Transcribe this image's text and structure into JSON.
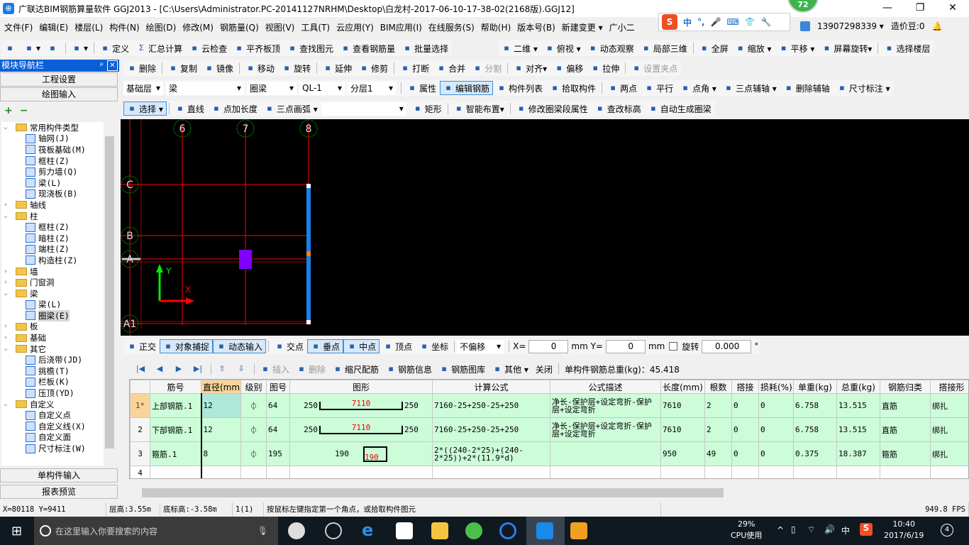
{
  "window": {
    "title": "广联达BIM钢筋算量软件 GGJ2013 - [C:\\Users\\Administrator.PC-20141127NRHM\\Desktop\\白龙村-2017-06-10-17-38-02(2168版).GGJ12]",
    "badge": "72",
    "minimize": "—",
    "restore": "❐",
    "close": "✕"
  },
  "menu": [
    "文件(F)",
    "编辑(E)",
    "楼层(L)",
    "构件(N)",
    "绘图(D)",
    "修改(M)",
    "钢筋量(Q)",
    "视图(V)",
    "工具(T)",
    "云应用(Y)",
    "BIM应用(I)",
    "在线服务(S)",
    "帮助(H)",
    "版本号(B)",
    "新建变更 ▾",
    "广小二"
  ],
  "account": {
    "phone": "13907298339 ▾",
    "beans": "造价豆:0"
  },
  "ime": {
    "logo": "S",
    "mode": "中",
    "punct": "°,"
  },
  "toolbar1": [
    {
      "icon": "new-file",
      "t": ""
    },
    {
      "icon": "open-folder",
      "t": "▾"
    },
    {
      "icon": "save",
      "t": ""
    },
    {
      "sep": 1
    },
    {
      "icon": "undo",
      "t": "▾"
    },
    {
      "sep": 1
    },
    {
      "icon": "define",
      "t": "定义"
    },
    {
      "icon": "sigma",
      "t": "汇总计算",
      "g": "Σ"
    },
    {
      "icon": "cloud-check",
      "t": "云检查"
    },
    {
      "icon": "align-slab-top",
      "t": "平齐板顶"
    },
    {
      "icon": "binoculars",
      "t": "查找图元"
    },
    {
      "icon": "glasses",
      "t": "查看钢筋量"
    },
    {
      "icon": "batch-select",
      "t": "批量选择"
    }
  ],
  "toolbar1b": [
    {
      "icon": "2d-view",
      "t": "二维 ▾"
    },
    {
      "icon": "top-view",
      "t": "俯视 ▾"
    },
    {
      "icon": "dynamic-orbit",
      "t": "动态观察"
    },
    {
      "icon": "local-3d",
      "t": "局部三维"
    },
    {
      "sep": 1
    },
    {
      "icon": "fullscreen",
      "t": "全屏"
    },
    {
      "icon": "zoom",
      "t": "缩放 ▾"
    },
    {
      "icon": "pan",
      "t": "平移 ▾"
    },
    {
      "icon": "screen-rotate",
      "t": "屏幕旋转▾"
    },
    {
      "sep": 1
    },
    {
      "icon": "select-floor",
      "t": "选择楼层"
    }
  ],
  "toolbar2": [
    {
      "icon": "eraser",
      "t": "删除"
    },
    {
      "sep": 1
    },
    {
      "icon": "copy",
      "t": "复制"
    },
    {
      "icon": "mirror",
      "t": "镜像"
    },
    {
      "sep": 1
    },
    {
      "icon": "move",
      "t": "移动"
    },
    {
      "icon": "rotate",
      "t": "旋转"
    },
    {
      "sep": 1
    },
    {
      "icon": "extend",
      "t": "延伸"
    },
    {
      "icon": "trim",
      "t": "修剪"
    },
    {
      "sep": 1
    },
    {
      "icon": "break",
      "t": "打断"
    },
    {
      "icon": "merge",
      "t": "合并"
    },
    {
      "icon": "split",
      "t": "分割",
      "dis": 1
    },
    {
      "sep": 1
    },
    {
      "icon": "align",
      "t": "对齐▾"
    },
    {
      "icon": "offset",
      "t": "偏移"
    },
    {
      "icon": "stretch",
      "t": "拉伸"
    },
    {
      "sep": 1
    },
    {
      "icon": "set-grip",
      "t": "设置夹点",
      "dis": 1
    }
  ],
  "toolbar3": [
    {
      "sel": "基础层",
      "w": 56
    },
    {
      "sel": "梁",
      "w": 110
    },
    {
      "sel": "圈梁",
      "w": 70
    },
    {
      "sel": "QL-1",
      "w": 64
    },
    {
      "sel": "分层1",
      "w": 68
    },
    {
      "sep": 1
    },
    {
      "icon": "properties",
      "t": "属性"
    },
    {
      "icon": "edit-rebar",
      "t": "编辑钢筋",
      "act": 1
    },
    {
      "icon": "component-list",
      "t": "构件列表"
    },
    {
      "icon": "pick-component",
      "t": "拾取构件"
    },
    {
      "sep": 1
    },
    {
      "icon": "two-point-axis",
      "t": "两点"
    },
    {
      "icon": "parallel-axis",
      "t": "平行"
    },
    {
      "icon": "point-angle-axis",
      "t": "点角 ▾"
    },
    {
      "icon": "three-point-axis",
      "t": "三点辅轴 ▾"
    },
    {
      "icon": "delete-axis",
      "t": "删除辅轴"
    },
    {
      "icon": "dimension",
      "t": "尺寸标注 ▾"
    }
  ],
  "toolbar4": [
    {
      "icon": "cursor",
      "t": "选择 ▾",
      "act": 1
    },
    {
      "sep": 1
    },
    {
      "icon": "line",
      "t": "直线"
    },
    {
      "icon": "point-length",
      "t": "点加长度"
    },
    {
      "icon": "arc",
      "t": "三点画弧 ▾"
    },
    {
      "sel": "",
      "w": 120
    },
    {
      "icon": "rectangle",
      "t": "矩形"
    },
    {
      "sep": 1
    },
    {
      "icon": "smart-layout",
      "t": "智能布置▾"
    },
    {
      "sep": 1
    },
    {
      "icon": "modify-segment",
      "t": "修改圈梁段属性"
    },
    {
      "icon": "elevation",
      "t": "查改标高"
    },
    {
      "icon": "auto-ring-beam",
      "t": "自动生成圈梁"
    }
  ],
  "snapbar": [
    {
      "icon": "ortho",
      "t": "正交"
    },
    {
      "icon": "object-snap",
      "t": "对象捕捉",
      "act": 1
    },
    {
      "icon": "dynamic-input",
      "t": "动态输入",
      "act": 1
    },
    {
      "sep": 1
    },
    {
      "icon": "intersection",
      "t": "交点"
    },
    {
      "icon": "perpendicular",
      "t": "垂点",
      "act": 1
    },
    {
      "icon": "midpoint",
      "t": "中点",
      "act": 1
    },
    {
      "icon": "vertex",
      "t": "顶点"
    },
    {
      "icon": "coordinate",
      "t": "坐标"
    },
    {
      "sep": 1
    },
    {
      "sel": "不偏移",
      "w": 66
    },
    {
      "sep": 1
    },
    {
      "lbl": "X="
    },
    {
      "inp": "0",
      "w": 56
    },
    {
      "lbl": "mm Y="
    },
    {
      "inp": "0",
      "w": 56
    },
    {
      "lbl": "mm"
    },
    {
      "chk": 1
    },
    {
      "lbl": "旋转"
    },
    {
      "inp": "0.000",
      "w": 70
    },
    {
      "lbl": "°"
    }
  ],
  "rebarbar": [
    {
      "icon": "first",
      "t": "",
      "g": "|◀",
      "dis": 1
    },
    {
      "icon": "prev",
      "t": "",
      "g": "◀",
      "dis": 1
    },
    {
      "icon": "next",
      "t": "",
      "g": "▶"
    },
    {
      "icon": "last",
      "t": "",
      "g": "▶|"
    },
    {
      "sep": 1
    },
    {
      "icon": "move-up",
      "t": "",
      "g": "⇧",
      "dis": 1
    },
    {
      "icon": "move-down",
      "t": "",
      "g": "⇩"
    },
    {
      "sep": 1
    },
    {
      "icon": "insert",
      "t": "插入",
      "dis": 1
    },
    {
      "icon": "delete",
      "t": "删除",
      "dis": 1
    },
    {
      "icon": "scale-rebar",
      "t": "缩尺配筋"
    },
    {
      "icon": "rebar-info",
      "t": "钢筋信息"
    },
    {
      "icon": "rebar-library",
      "t": "钢筋图库"
    },
    {
      "icon": "other",
      "t": "其他 ▾"
    },
    {
      "t": "关闭"
    },
    {
      "sep": 1
    },
    {
      "t": "单构件钢筋总重(kg)：45.418"
    }
  ],
  "nav": {
    "title": "模块导航栏",
    "pin": "ᵖ",
    "close": "✕",
    "project_settings": "工程设置",
    "drawing_input": "绘图输入",
    "single_input": "单构件输入",
    "report_preview": "报表预览",
    "expand": "+",
    "collapse": "−"
  },
  "tree": [
    {
      "f": 1,
      "o": 1,
      "t": "常用构件类型"
    },
    {
      "t": "轴网(J)"
    },
    {
      "t": "筏板基础(M)"
    },
    {
      "t": "框柱(Z)"
    },
    {
      "t": "剪力墙(Q)"
    },
    {
      "t": "梁(L)"
    },
    {
      "t": "现浇板(B)"
    },
    {
      "f": 1,
      "t": "轴线"
    },
    {
      "f": 1,
      "o": 1,
      "t": "柱"
    },
    {
      "t": "框柱(Z)"
    },
    {
      "t": "暗柱(Z)"
    },
    {
      "t": "端柱(Z)"
    },
    {
      "t": "构造柱(Z)"
    },
    {
      "f": 1,
      "t": "墙"
    },
    {
      "f": 1,
      "t": "门窗洞"
    },
    {
      "f": 1,
      "o": 1,
      "t": "梁"
    },
    {
      "t": "梁(L)"
    },
    {
      "t": "圈梁(E)",
      "sel": 1
    },
    {
      "f": 1,
      "t": "板"
    },
    {
      "f": 1,
      "t": "基础"
    },
    {
      "f": 1,
      "o": 1,
      "t": "其它"
    },
    {
      "t": "后浇带(JD)"
    },
    {
      "t": "挑檐(T)"
    },
    {
      "t": "栏板(K)"
    },
    {
      "t": "压顶(YD)"
    },
    {
      "f": 1,
      "o": 1,
      "t": "自定义"
    },
    {
      "t": "自定义点"
    },
    {
      "t": "自定义线(X)"
    },
    {
      "t": "自定义面"
    },
    {
      "t": "尺寸标注(W)"
    }
  ],
  "canvas": {
    "axes_vertical": [
      "6",
      "7",
      "8"
    ],
    "axes_horizontal": [
      "C",
      "B",
      "A",
      "A1"
    ],
    "ucs_x": "X",
    "ucs_y": "Y",
    "colors": {
      "axis": "#ff0000",
      "bubble": "#008000",
      "beam": "#1a7fe8",
      "column": "#8000ff"
    }
  },
  "table": {
    "headers": [
      "",
      "筋号",
      "直径(mm)",
      "级别",
      "图号",
      "图形",
      "计算公式",
      "公式描述",
      "长度(mm)",
      "根数",
      "搭接",
      "损耗(%)",
      "单重(kg)",
      "总重(kg)",
      "钢筋归类",
      "搭接形"
    ],
    "rows": [
      {
        "idx": "1*",
        "name": "上部钢筋.1",
        "d": "12",
        "grade": "⏀",
        "fig": "64",
        "shape": {
          "left": "250",
          "mid": "7110",
          "right": "250"
        },
        "formula": "7160-25+250-25+250",
        "desc": "净长-保护层+设定弯折-保护层+设定弯折",
        "len": "7610",
        "count": "2",
        "lap": "0",
        "loss": "0",
        "unit": "6.758",
        "total": "13.515",
        "cat": "直筋",
        "laptype": "绑扎"
      },
      {
        "idx": "2",
        "name": "下部钢筋.1",
        "d": "12",
        "grade": "⏀",
        "fig": "64",
        "shape": {
          "left": "250",
          "mid": "7110",
          "right": "250"
        },
        "formula": "7160-25+250-25+250",
        "desc": "净长-保护层+设定弯折-保护层+设定弯折",
        "len": "7610",
        "count": "2",
        "lap": "0",
        "loss": "0",
        "unit": "6.758",
        "total": "13.515",
        "cat": "直筋",
        "laptype": "绑扎"
      },
      {
        "idx": "3",
        "name": "箍筋.1",
        "d": "8",
        "grade": "⏀",
        "fig": "195",
        "shape": {
          "left": "190",
          "mid": "190",
          "right": ""
        },
        "formula": "2*((240-2*25)+(240-2*25))+2*(11.9*d)",
        "desc": "",
        "len": "950",
        "count": "49",
        "lap": "0",
        "loss": "0",
        "unit": "0.375",
        "total": "18.387",
        "cat": "箍筋",
        "laptype": "绑扎"
      }
    ],
    "empty_row": "4"
  },
  "status": [
    "X=80118 Y=9411",
    "层高:3.55m",
    "底标高:-3.58m",
    "1(1)",
    "按鼠标左键指定第一个角点，或拾取构件图元",
    "949.8 FPS"
  ],
  "taskbar": {
    "search": "在这里输入你要搜索的内容",
    "cpu_pct": "29%",
    "cpu_label": "CPU使用",
    "ime": "中",
    "time": "10:40",
    "date": "2017/6/19",
    "notifications": "4"
  }
}
